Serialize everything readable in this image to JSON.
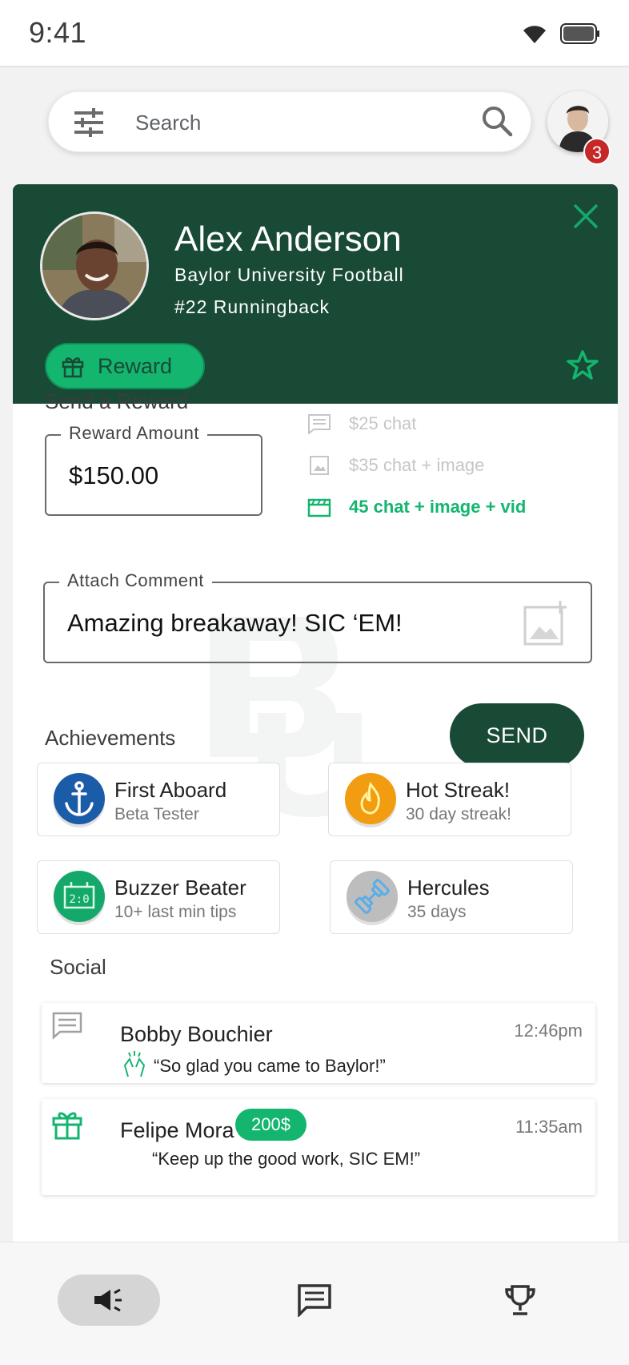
{
  "status_bar": {
    "time": "9:41"
  },
  "search": {
    "placeholder": "Search"
  },
  "notifications": {
    "count": "3"
  },
  "athlete": {
    "name": "Alex Anderson",
    "team": "Baylor University Football",
    "position": "#22 Runningback",
    "reward_button_label": "Reward"
  },
  "send_reward": {
    "title": "Send a Reward",
    "amount_label": "Reward Amount",
    "amount_value": "$150.00",
    "tiers": [
      {
        "label": "$25 chat",
        "icon": "chat-icon",
        "active": false
      },
      {
        "label": "$35 chat + image",
        "icon": "image-icon",
        "active": false
      },
      {
        "label": "45 chat + image + vid",
        "icon": "video-icon",
        "active": true
      }
    ],
    "comment_label": "Attach Comment",
    "comment_value": "Amazing breakaway! SIC ‘EM!",
    "send_label": "SEND"
  },
  "achievements": {
    "title": "Achievements",
    "items": [
      {
        "title": "First Aboard",
        "subtitle": "Beta Tester",
        "icon": "anchor-icon",
        "color": "#1a5ca8"
      },
      {
        "title": "Hot Streak!",
        "subtitle": "30 day streak!",
        "icon": "flame-icon",
        "color": "#f29c11"
      },
      {
        "title": "Buzzer Beater",
        "subtitle": "10+ last min tips",
        "icon": "scoreboard-icon",
        "color": "#14a86a"
      },
      {
        "title": "Hercules",
        "subtitle": "35 days",
        "icon": "dumbbell-icon",
        "color": "#bdbdbd"
      }
    ]
  },
  "social": {
    "title": "Social",
    "items": [
      {
        "name": "Bobby Bouchier",
        "time": "12:46pm",
        "message": "“So glad you came to Baylor!”",
        "icon": "chat-icon"
      },
      {
        "name": "Felipe Mora",
        "time": "11:35am",
        "message": "“Keep up the good work, SIC EM!”",
        "badge": "200$",
        "icon": "gift-icon"
      }
    ]
  },
  "colors": {
    "primary": "#184a36",
    "accent": "#14b56f",
    "badge": "#c62828"
  },
  "nav": [
    {
      "icon": "megaphone-icon",
      "active": true
    },
    {
      "icon": "chat-icon",
      "active": false
    },
    {
      "icon": "trophy-icon",
      "active": false
    }
  ]
}
